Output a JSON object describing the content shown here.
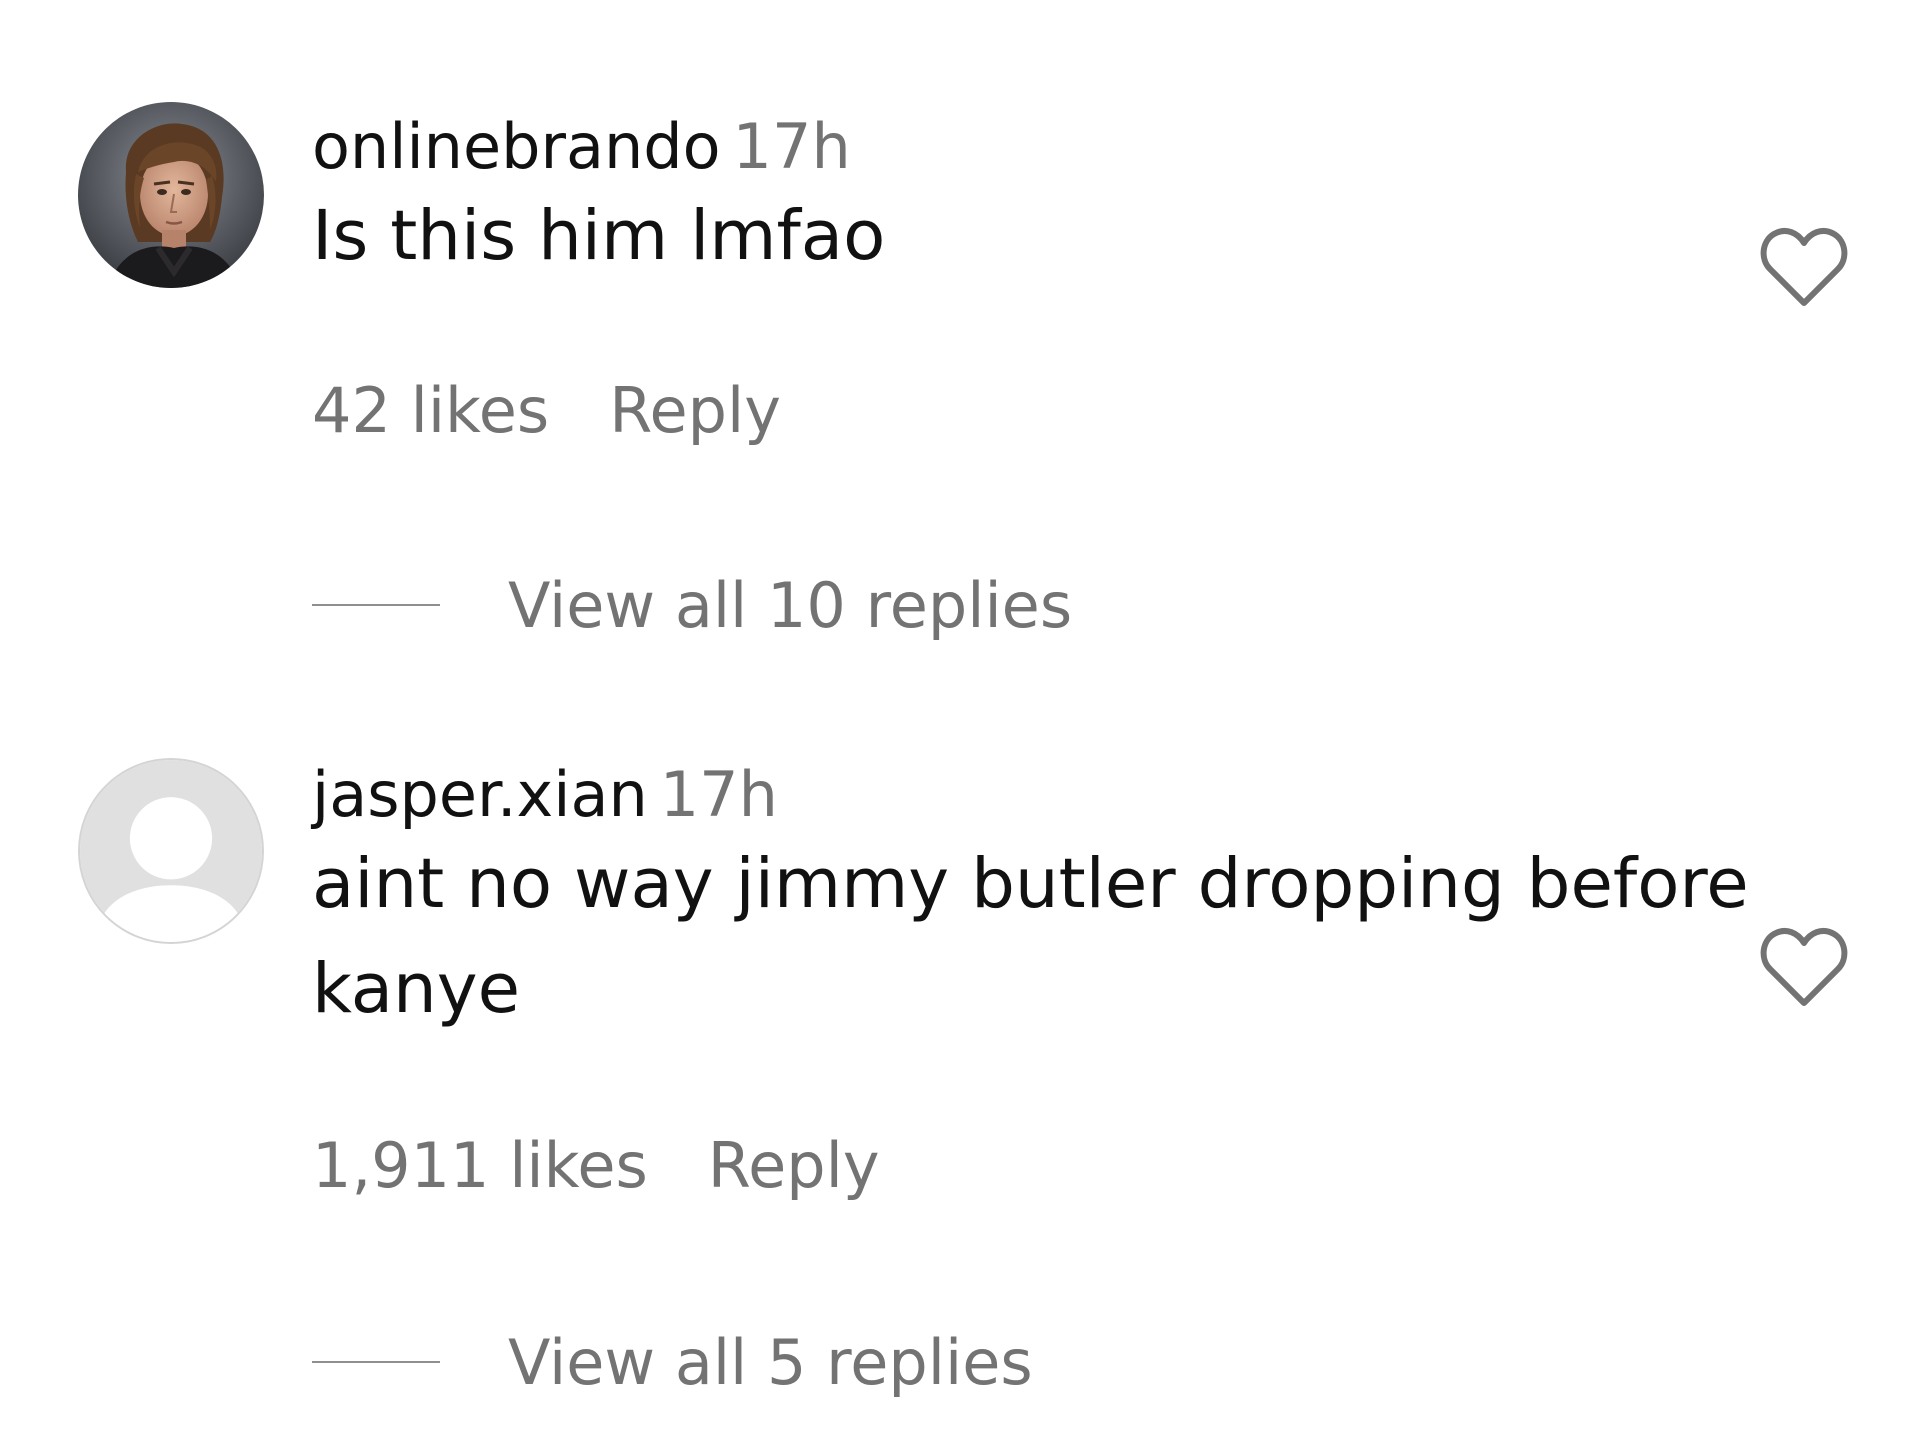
{
  "comments": [
    {
      "username": "onlinebrando",
      "timestamp": "17h",
      "text": "Is this him lmfao",
      "likes": "42 likes",
      "reply_label": "Reply",
      "view_replies": "View all 10 replies",
      "avatar_icon": "profile-photo",
      "like_icon": "heart-outline-icon"
    },
    {
      "username": "jasper.xian",
      "timestamp": "17h",
      "text": "aint no way jimmy butler dropping before kanye",
      "likes": "1,911 likes",
      "reply_label": "Reply",
      "view_replies": "View all 5 replies",
      "avatar_icon": "default-avatar-icon",
      "like_icon": "heart-outline-icon"
    }
  ],
  "colors": {
    "primary_text": "#111111",
    "secondary_text": "#737373",
    "divider": "#8f8f8f",
    "heart_outline": "#737373",
    "default_avatar_bg": "#e0e0e0"
  }
}
